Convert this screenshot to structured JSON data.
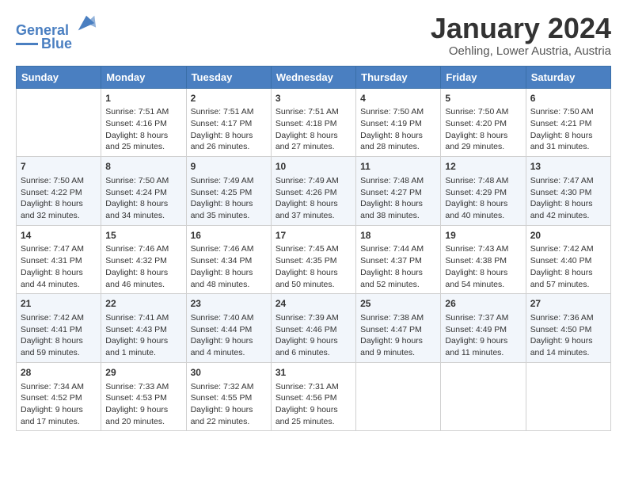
{
  "header": {
    "logo_line1": "General",
    "logo_line2": "Blue",
    "month": "January 2024",
    "location": "Oehling, Lower Austria, Austria"
  },
  "days_of_week": [
    "Sunday",
    "Monday",
    "Tuesday",
    "Wednesday",
    "Thursday",
    "Friday",
    "Saturday"
  ],
  "weeks": [
    [
      {
        "day": "",
        "content": ""
      },
      {
        "day": "1",
        "content": "Sunrise: 7:51 AM\nSunset: 4:16 PM\nDaylight: 8 hours\nand 25 minutes."
      },
      {
        "day": "2",
        "content": "Sunrise: 7:51 AM\nSunset: 4:17 PM\nDaylight: 8 hours\nand 26 minutes."
      },
      {
        "day": "3",
        "content": "Sunrise: 7:51 AM\nSunset: 4:18 PM\nDaylight: 8 hours\nand 27 minutes."
      },
      {
        "day": "4",
        "content": "Sunrise: 7:50 AM\nSunset: 4:19 PM\nDaylight: 8 hours\nand 28 minutes."
      },
      {
        "day": "5",
        "content": "Sunrise: 7:50 AM\nSunset: 4:20 PM\nDaylight: 8 hours\nand 29 minutes."
      },
      {
        "day": "6",
        "content": "Sunrise: 7:50 AM\nSunset: 4:21 PM\nDaylight: 8 hours\nand 31 minutes."
      }
    ],
    [
      {
        "day": "7",
        "content": "Sunrise: 7:50 AM\nSunset: 4:22 PM\nDaylight: 8 hours\nand 32 minutes."
      },
      {
        "day": "8",
        "content": "Sunrise: 7:50 AM\nSunset: 4:24 PM\nDaylight: 8 hours\nand 34 minutes."
      },
      {
        "day": "9",
        "content": "Sunrise: 7:49 AM\nSunset: 4:25 PM\nDaylight: 8 hours\nand 35 minutes."
      },
      {
        "day": "10",
        "content": "Sunrise: 7:49 AM\nSunset: 4:26 PM\nDaylight: 8 hours\nand 37 minutes."
      },
      {
        "day": "11",
        "content": "Sunrise: 7:48 AM\nSunset: 4:27 PM\nDaylight: 8 hours\nand 38 minutes."
      },
      {
        "day": "12",
        "content": "Sunrise: 7:48 AM\nSunset: 4:29 PM\nDaylight: 8 hours\nand 40 minutes."
      },
      {
        "day": "13",
        "content": "Sunrise: 7:47 AM\nSunset: 4:30 PM\nDaylight: 8 hours\nand 42 minutes."
      }
    ],
    [
      {
        "day": "14",
        "content": "Sunrise: 7:47 AM\nSunset: 4:31 PM\nDaylight: 8 hours\nand 44 minutes."
      },
      {
        "day": "15",
        "content": "Sunrise: 7:46 AM\nSunset: 4:32 PM\nDaylight: 8 hours\nand 46 minutes."
      },
      {
        "day": "16",
        "content": "Sunrise: 7:46 AM\nSunset: 4:34 PM\nDaylight: 8 hours\nand 48 minutes."
      },
      {
        "day": "17",
        "content": "Sunrise: 7:45 AM\nSunset: 4:35 PM\nDaylight: 8 hours\nand 50 minutes."
      },
      {
        "day": "18",
        "content": "Sunrise: 7:44 AM\nSunset: 4:37 PM\nDaylight: 8 hours\nand 52 minutes."
      },
      {
        "day": "19",
        "content": "Sunrise: 7:43 AM\nSunset: 4:38 PM\nDaylight: 8 hours\nand 54 minutes."
      },
      {
        "day": "20",
        "content": "Sunrise: 7:42 AM\nSunset: 4:40 PM\nDaylight: 8 hours\nand 57 minutes."
      }
    ],
    [
      {
        "day": "21",
        "content": "Sunrise: 7:42 AM\nSunset: 4:41 PM\nDaylight: 8 hours\nand 59 minutes."
      },
      {
        "day": "22",
        "content": "Sunrise: 7:41 AM\nSunset: 4:43 PM\nDaylight: 9 hours\nand 1 minute."
      },
      {
        "day": "23",
        "content": "Sunrise: 7:40 AM\nSunset: 4:44 PM\nDaylight: 9 hours\nand 4 minutes."
      },
      {
        "day": "24",
        "content": "Sunrise: 7:39 AM\nSunset: 4:46 PM\nDaylight: 9 hours\nand 6 minutes."
      },
      {
        "day": "25",
        "content": "Sunrise: 7:38 AM\nSunset: 4:47 PM\nDaylight: 9 hours\nand 9 minutes."
      },
      {
        "day": "26",
        "content": "Sunrise: 7:37 AM\nSunset: 4:49 PM\nDaylight: 9 hours\nand 11 minutes."
      },
      {
        "day": "27",
        "content": "Sunrise: 7:36 AM\nSunset: 4:50 PM\nDaylight: 9 hours\nand 14 minutes."
      }
    ],
    [
      {
        "day": "28",
        "content": "Sunrise: 7:34 AM\nSunset: 4:52 PM\nDaylight: 9 hours\nand 17 minutes."
      },
      {
        "day": "29",
        "content": "Sunrise: 7:33 AM\nSunset: 4:53 PM\nDaylight: 9 hours\nand 20 minutes."
      },
      {
        "day": "30",
        "content": "Sunrise: 7:32 AM\nSunset: 4:55 PM\nDaylight: 9 hours\nand 22 minutes."
      },
      {
        "day": "31",
        "content": "Sunrise: 7:31 AM\nSunset: 4:56 PM\nDaylight: 9 hours\nand 25 minutes."
      },
      {
        "day": "",
        "content": ""
      },
      {
        "day": "",
        "content": ""
      },
      {
        "day": "",
        "content": ""
      }
    ]
  ]
}
